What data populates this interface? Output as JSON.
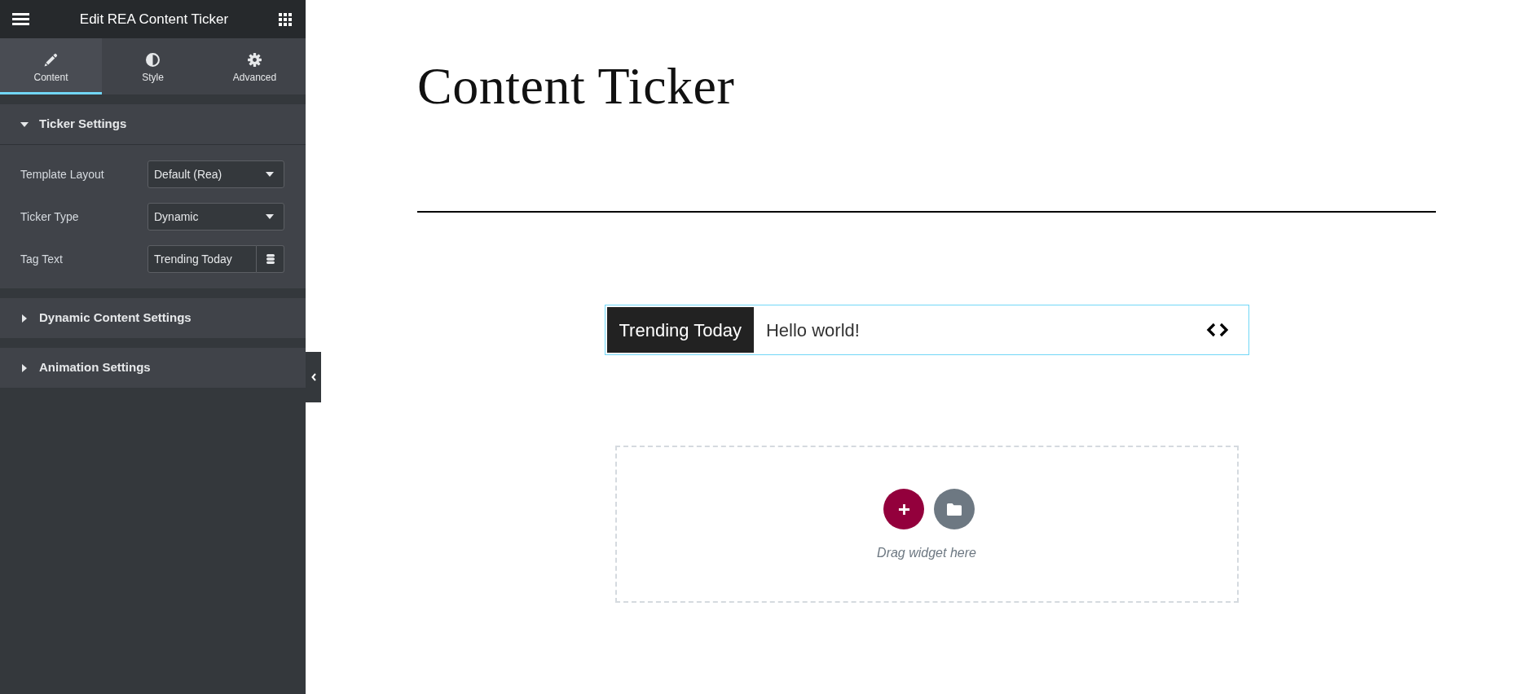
{
  "editor_panel": {
    "title": "Edit REA Content Ticker",
    "tabs": [
      {
        "label": "Content",
        "selected": true
      },
      {
        "label": "Style",
        "selected": false
      },
      {
        "label": "Advanced",
        "selected": false
      }
    ],
    "sections": [
      {
        "title": "Ticker Settings",
        "expanded": true,
        "controls": [
          {
            "kind": "select",
            "label": "Template Layout",
            "value": "Default (Rea)"
          },
          {
            "kind": "select",
            "label": "Ticker Type",
            "value": "Dynamic"
          },
          {
            "kind": "text",
            "label": "Tag Text",
            "value": "Trending Today"
          }
        ]
      },
      {
        "title": "Dynamic Content Settings",
        "expanded": false
      },
      {
        "title": "Animation Settings",
        "expanded": false
      }
    ]
  },
  "page": {
    "heading": "Content Ticker",
    "ticker": {
      "tag": "Trending Today",
      "items": [
        "Hello world!"
      ]
    },
    "drop_zone": {
      "hint": "Drag widget here"
    }
  }
}
